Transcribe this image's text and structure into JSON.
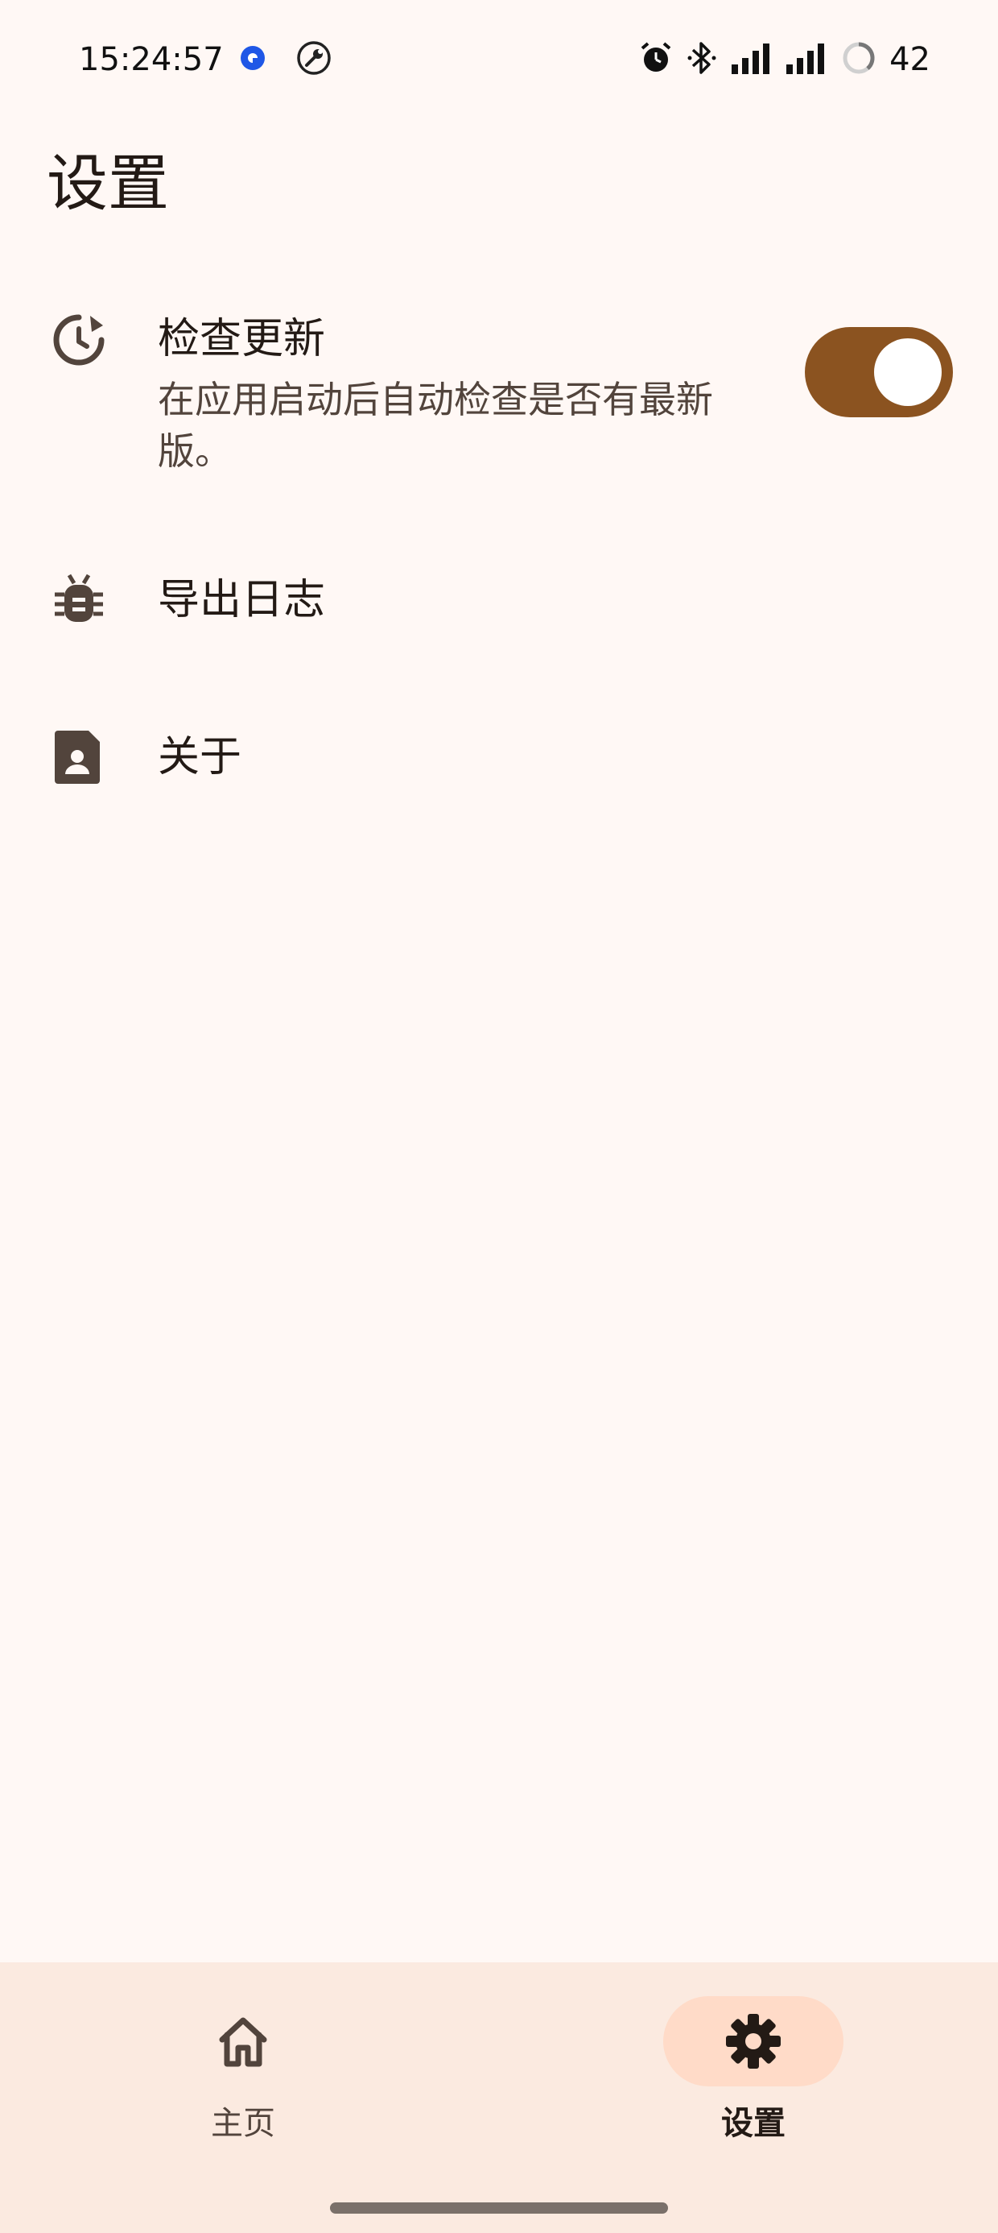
{
  "status_bar": {
    "time": "15:24:57",
    "battery": "42",
    "icons": [
      "chat-bubble-icon",
      "wrench-icon",
      "alarm-icon",
      "bluetooth-icon",
      "signal-icon",
      "signal-icon",
      "battery-ring-icon"
    ]
  },
  "page": {
    "title": "设置"
  },
  "settings": [
    {
      "icon": "update-history-icon",
      "title": "检查更新",
      "subtitle": "在应用启动后自动检查是否有最新版。",
      "toggle_on": true
    },
    {
      "icon": "bug-icon",
      "title": "导出日志"
    },
    {
      "icon": "contact-card-icon",
      "title": "关于"
    }
  ],
  "bottom_nav": {
    "items": [
      {
        "label": "主页",
        "icon": "home-icon",
        "active": false
      },
      {
        "label": "设置",
        "icon": "gear-icon",
        "active": true
      }
    ]
  },
  "colors": {
    "background": "#fff8f5",
    "accent": "#8b5320",
    "nav_background": "#fbeae0",
    "nav_active": "#ffdbc8"
  }
}
